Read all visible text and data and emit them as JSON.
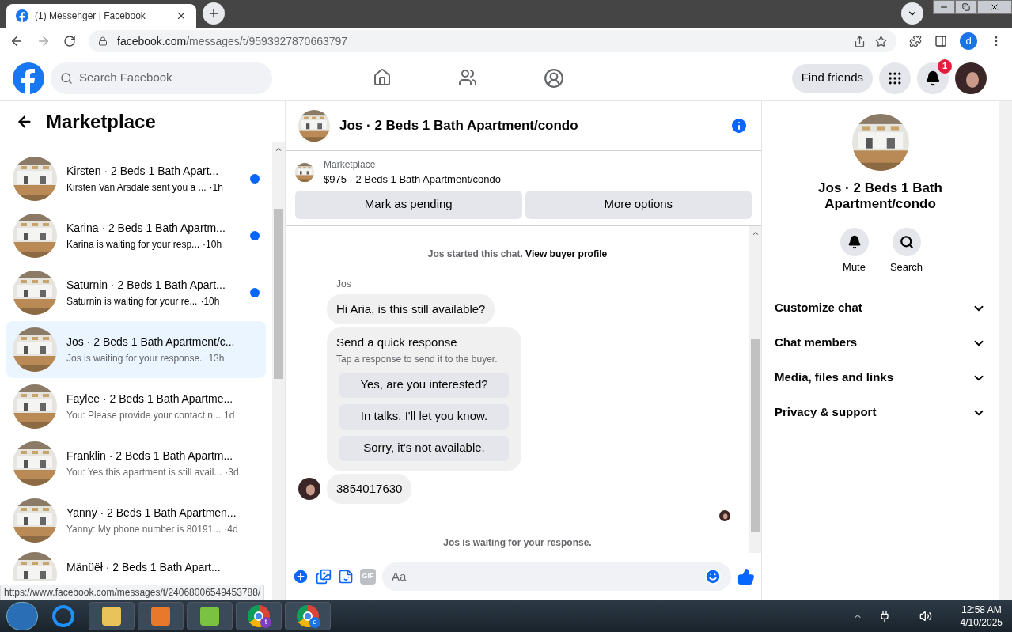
{
  "browser": {
    "tab_title": "(1) Messenger | Facebook",
    "url_domain": "facebook.com",
    "url_path": "/messages/t/9593927870663797",
    "profile_letter": "d"
  },
  "header": {
    "search_placeholder": "Search Facebook",
    "find_friends": "Find friends",
    "notification_count": "1"
  },
  "sidebar": {
    "title": "Marketplace",
    "conversations": [
      {
        "title": "Kirsten · 2 Beds 1 Bath Apart...",
        "preview": "Kirsten Van Arsdale sent you a ...",
        "time": "·1h",
        "unread": true,
        "selected": false
      },
      {
        "title": "Karina · 2 Beds 1 Bath Apartm...",
        "preview": "Karina is waiting for your resp...",
        "time": "·10h",
        "unread": true,
        "selected": false
      },
      {
        "title": "Saturnin · 2 Beds 1 Bath Apart...",
        "preview": "Saturnin is waiting for your re...",
        "time": "·10h",
        "unread": true,
        "selected": false
      },
      {
        "title": "Jos · 2 Beds 1 Bath Apartment/c...",
        "preview": "Jos is waiting for your response.",
        "time": "·13h",
        "unread": false,
        "selected": true
      },
      {
        "title": "Faylee · 2 Beds 1 Bath Apartme...",
        "preview": "You: Please provide your contact n...",
        "time": "1d",
        "unread": false,
        "selected": false
      },
      {
        "title": "Franklin · 2 Beds 1 Bath Apartm...",
        "preview": "You: Yes this apartment is still avail...",
        "time": "·3d",
        "unread": false,
        "selected": false
      },
      {
        "title": "Yanny · 2 Beds 1 Bath Apartmen...",
        "preview": "Yanny: My phone number is 80191...",
        "time": "·4d",
        "unread": false,
        "selected": false
      },
      {
        "title": "Mänüëł · 2 Beds 1 Bath Apart...",
        "unread": false,
        "selected": false
      }
    ]
  },
  "chat": {
    "title": "Jos · 2 Beds 1 Bath Apartment/condo",
    "listing_source": "Marketplace",
    "listing_title": "$975 - 2 Beds 1 Bath Apartment/condo",
    "actions": [
      "Mark as pending",
      "More options"
    ],
    "started_note": "Jos started this chat.",
    "started_link": "View buyer profile",
    "sender": "Jos",
    "first_message": "Hi Aria, is this still available?",
    "quick_title": "Send a quick response",
    "quick_hint": "Tap a response to send it to the buyer.",
    "quick_responses": [
      "Yes, are you interested?",
      "In talks. I'll let you know.",
      "Sorry, it's not available."
    ],
    "reply": "3854017630",
    "waiting_note": "Jos is waiting for your response.",
    "composer_placeholder": "Aa",
    "gif_label": "GIF"
  },
  "details": {
    "title": "Jos · 2 Beds 1 Bath Apartment/condo",
    "buttons": [
      "Mute",
      "Search"
    ],
    "sections": [
      {
        "label": "Customize chat",
        "expanded": false
      },
      {
        "label": "Chat members",
        "expanded": false
      },
      {
        "label": "Media, files and links",
        "expanded": false
      },
      {
        "label": "Privacy & support",
        "expanded": false
      }
    ]
  },
  "status_url": "https://www.facebook.com/messages/t/24068006549453788/",
  "taskbar": {
    "chrome_badges": [
      "t",
      "d"
    ],
    "time": "12:58 AM",
    "date": "4/10/2025"
  }
}
